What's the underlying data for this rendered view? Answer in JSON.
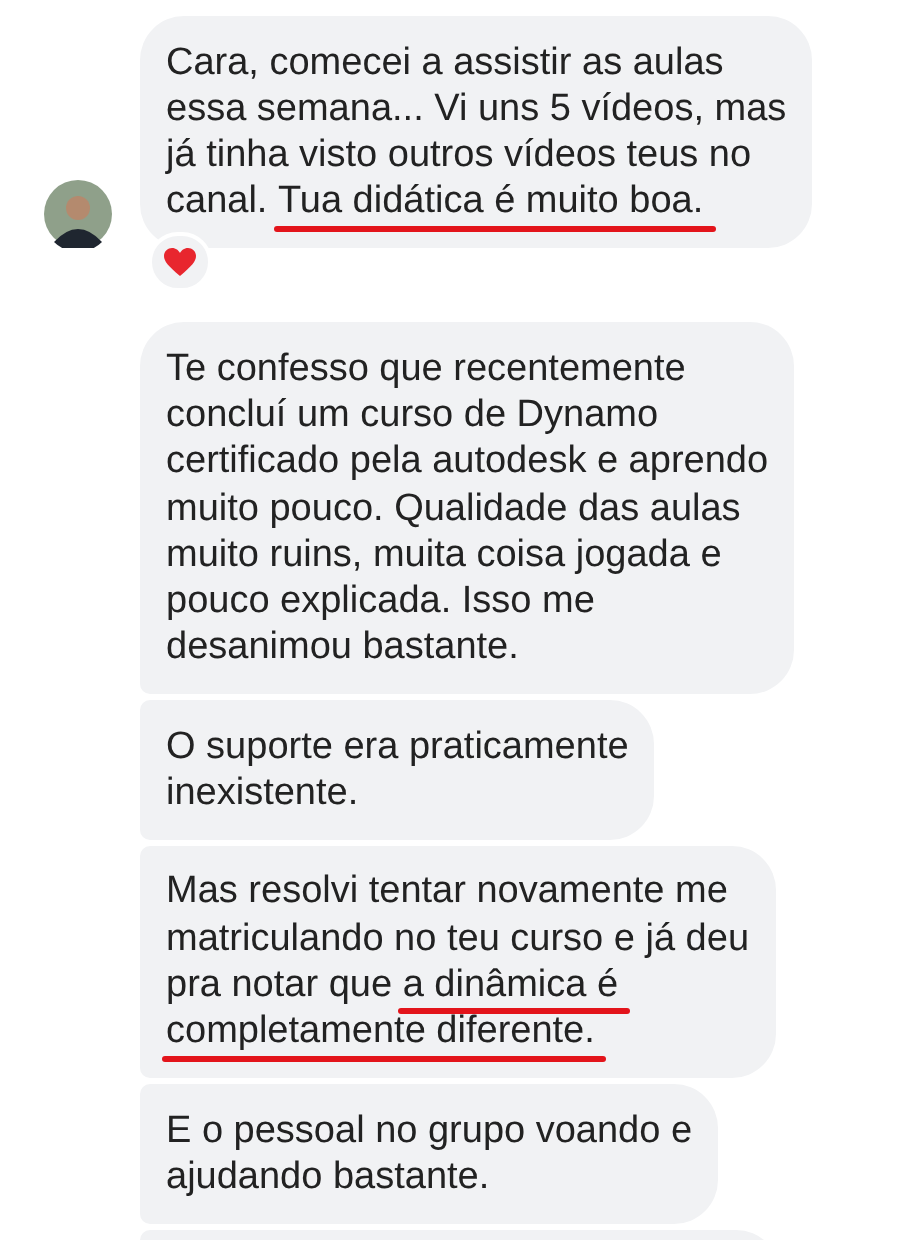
{
  "messages": [
    {
      "avatar": true,
      "reaction": true,
      "lines": [
        [
          {
            "text": "Cara, comecei a assistir as aulas",
            "underlined": false
          }
        ],
        [
          {
            "text": "essa semana... Vi uns 5 vídeos, mas",
            "underlined": false
          }
        ],
        [
          {
            "text": "já tinha visto outros vídeos teus no",
            "underlined": false
          }
        ],
        [
          {
            "text": "canal. ",
            "underlined": false
          },
          {
            "text": "Tua didática é muito boa.",
            "underlined": true
          }
        ]
      ]
    },
    {
      "avatar": false,
      "reaction": false,
      "lines": [
        [
          {
            "text": "Te confesso que recentemente",
            "underlined": false
          }
        ],
        [
          {
            "text": "concluí um curso de Dynamo",
            "underlined": false
          }
        ],
        [
          {
            "text": "certificado pela autodesk e aprendo",
            "underlined": false
          }
        ],
        [
          {
            "text": "muito pouco. Qualidade das aulas",
            "underlined": false
          }
        ],
        [
          {
            "text": "muito ruins, muita coisa jogada e",
            "underlined": false
          }
        ],
        [
          {
            "text": "pouco explicada. Isso me",
            "underlined": false
          }
        ],
        [
          {
            "text": "desanimou bastante.",
            "underlined": false
          }
        ]
      ]
    },
    {
      "avatar": false,
      "reaction": false,
      "lines": [
        [
          {
            "text": "O suporte era praticamente",
            "underlined": false
          }
        ],
        [
          {
            "text": "inexistente.",
            "underlined": false
          }
        ]
      ]
    },
    {
      "avatar": false,
      "reaction": false,
      "lines": [
        [
          {
            "text": "Mas resolvi tentar novamente me",
            "underlined": false
          }
        ],
        [
          {
            "text": "matriculando no teu curso e já deu",
            "underlined": false
          }
        ],
        [
          {
            "text": "pra notar que ",
            "underlined": false
          },
          {
            "text": "a dinâmica é",
            "underlined": true
          }
        ],
        [
          {
            "text": "completamente diferente.",
            "underlined": true
          }
        ]
      ]
    },
    {
      "avatar": false,
      "reaction": false,
      "lines": [
        [
          {
            "text": "E o pessoal no grupo voando e",
            "underlined": false
          }
        ],
        [
          {
            "text": "ajudando bastante.",
            "underlined": false
          }
        ]
      ]
    }
  ],
  "more_below": true
}
